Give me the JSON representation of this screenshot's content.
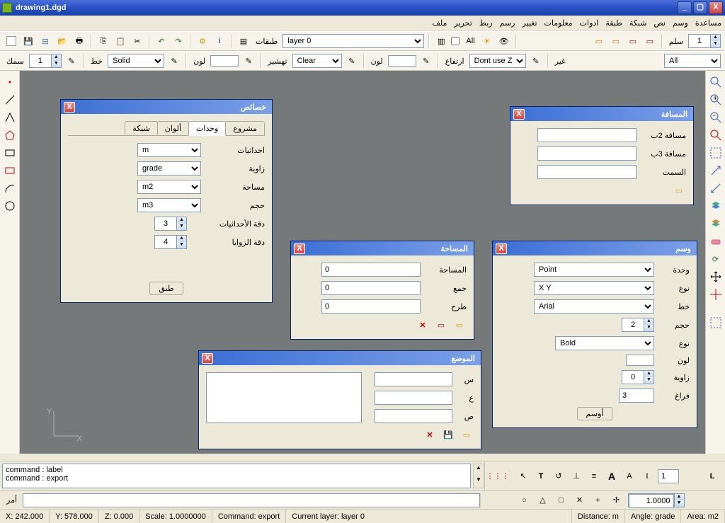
{
  "window": {
    "title": "drawing1.dgd"
  },
  "menu": [
    "مساعدة",
    "وسم",
    "نص",
    "شبكة",
    "طبقة",
    "ادوات",
    "معلومات",
    "تغيير",
    "رسم",
    "ربط",
    "تحرير",
    "ملف"
  ],
  "toolbar1": {
    "layers_label": "طبقات",
    "layer_sel": "layer 0",
    "all_label": "All",
    "slm": "سلم",
    "slm_val": "1"
  },
  "toolbar2": {
    "smk": "سمك",
    "smk_val": "1",
    "khat": "خط",
    "line_style": "Solid",
    "lawn": "لون",
    "tahshir": "تهشير",
    "hatch": "Clear",
    "irtifa": "ارتفاع",
    "z_use": "Dont use Z",
    "ghyr": "غير",
    "filter": "All"
  },
  "properties": {
    "title": "خصائص",
    "tabs": {
      "project": "مشروع",
      "units": "وحدات",
      "colors": "ألوان",
      "grid": "شبكة"
    },
    "coords": "احداثيات",
    "coords_v": "m",
    "angle": "زاوية",
    "angle_v": "grade",
    "area": "مساحة",
    "area_v": "m2",
    "volume": "حجم",
    "volume_v": "m3",
    "prec_coords": "دقة الأحداثيات",
    "prec_coords_v": "3",
    "prec_angle": "دقة الزوايا",
    "prec_angle_v": "4",
    "apply": "طبق"
  },
  "distance": {
    "title": "المسافة",
    "d2": "مسافة 2ب",
    "d3": "مسافة 3ب",
    "azimuth": "السمت"
  },
  "area_dlg": {
    "title": "المساحة",
    "area": "المساحة",
    "area_v": "0",
    "add": "جمع",
    "add_v": "0",
    "sub": "طرح",
    "sub_v": "0"
  },
  "position": {
    "title": "الموضع",
    "x": "س",
    "y": "ع",
    "z": "ص"
  },
  "label": {
    "title": "وسم",
    "unit": "وحدة",
    "unit_v": "Point",
    "type1": "نوع",
    "type1_v": "X Y",
    "font": "خط",
    "font_v": "Arial",
    "size": "حجم",
    "size_v": "2",
    "type2": "نوع",
    "type2_v": "Bold",
    "color": "لون",
    "angle": "زاوية",
    "angle_v": "0",
    "space": "فراغ",
    "space_v": "3",
    "btn": "أوسم"
  },
  "cmdlog": {
    "l1": "command : label",
    "l2": "command : export"
  },
  "cmd_label": "أمر",
  "snap": {
    "val": "1",
    "scale": "1.0000"
  },
  "status": {
    "x": "X: 242.000",
    "y": "Y: 578.000",
    "z": "Z: 0.000",
    "scale": "Scale: 1.0000000",
    "cmd": "Command: export",
    "layer": "Current layer: layer 0",
    "dist": "Distance: m",
    "angle": "Angle: grade",
    "area": "Area: m2"
  },
  "axis": {
    "x": "X",
    "y": "Y"
  }
}
